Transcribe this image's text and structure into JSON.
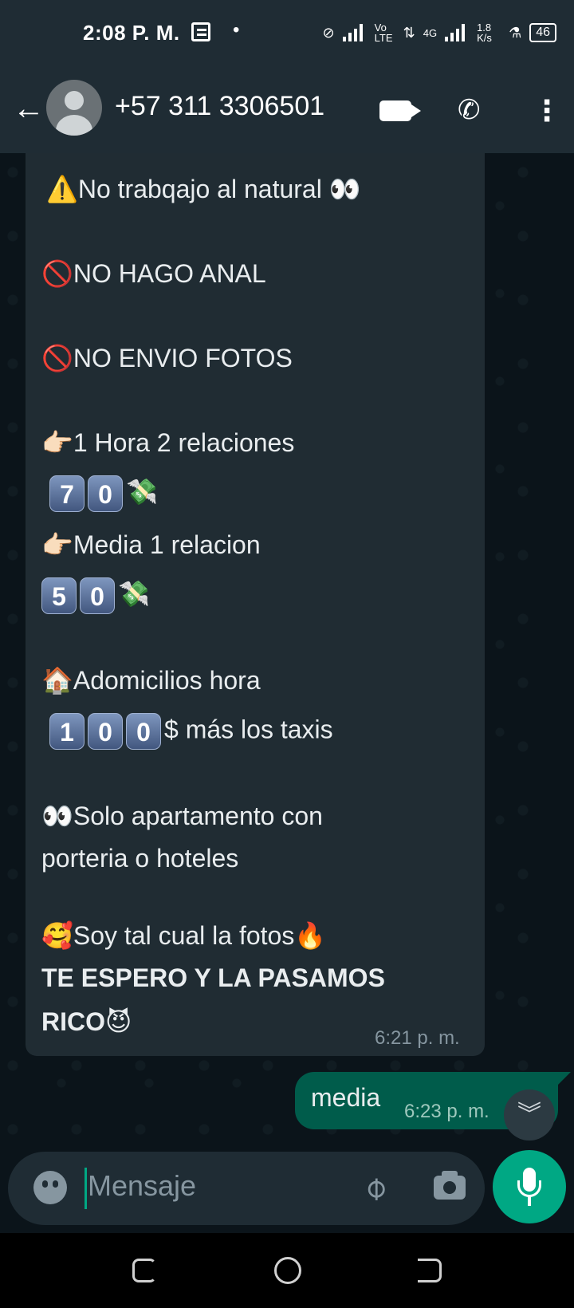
{
  "status_bar": {
    "time": "2:08 P. M.",
    "dot": "•",
    "network": "Vo LTE",
    "network_2": "4G",
    "speed": "1.8 K/s",
    "battery": "46"
  },
  "header": {
    "contact": "+57 311 3306501"
  },
  "incoming_message": {
    "lines": [
      "⚠️No trabqajo al natural 👀",
      "🚫NO HAGO ANAL",
      "🚫NO ENVIO FOTOS",
      "👉🏻1 Hora 2 relaciones",
      "7",
      "0",
      "💸",
      "👉🏻Media  1 relacion",
      "5",
      "0",
      "💸",
      "🏠Adomicilios hora",
      "1",
      "0",
      "0",
      "$ más los taxis",
      "👀Solo apartamento con",
      "porteria o hoteles",
      "🥰Soy tal cual la fotos🔥",
      "TE ESPERO Y LA PASAMOS",
      "RICO😈"
    ],
    "time": "6:21 p. m."
  },
  "outgoing_message": {
    "text": "media",
    "time": "6:23 p. m."
  },
  "composer": {
    "placeholder": "Mensaje"
  },
  "icons": {
    "back": "arrow-left-icon",
    "video": "video-call-icon",
    "phone": "phone-icon",
    "menu": "more-vertical-icon",
    "emoji": "emoji-icon",
    "attach": "paperclip-icon",
    "camera": "camera-icon",
    "mic": "mic-icon",
    "scroll": "chevron-double-down-icon"
  },
  "colors": {
    "header_bg": "#1f2c34",
    "incoming_bubble": "#202c33",
    "outgoing_bubble": "#005c4b",
    "accent": "#00a884"
  }
}
